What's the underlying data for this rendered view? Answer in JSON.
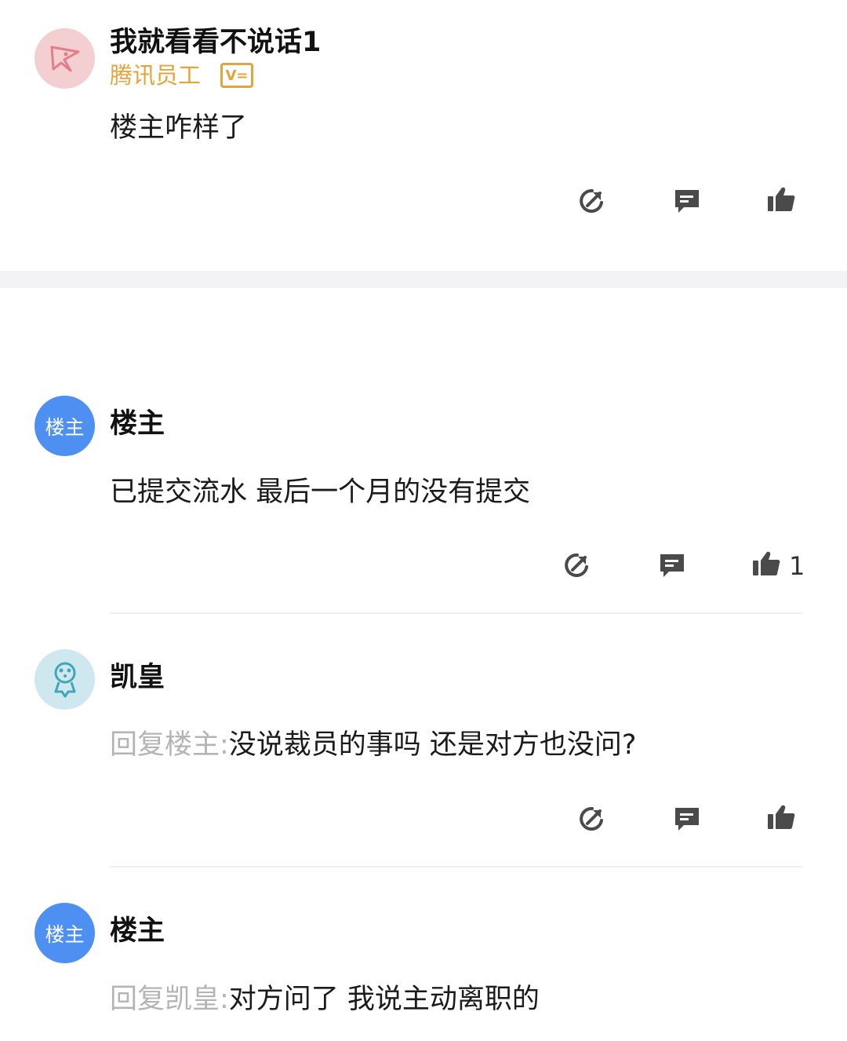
{
  "comments": [
    {
      "author": "我就看看不说话1",
      "badge": "腾讯员工",
      "badge_icon": "V=",
      "text": "楼主咋样了",
      "like_count": ""
    },
    {
      "author": "楼主",
      "avatar_text": "楼主",
      "text": "已提交流水 最后一个月的没有提交",
      "like_count": "1"
    },
    {
      "author": "凯皇",
      "reply_prefix": "回复楼主:",
      "text": "没说裁员的事吗  还是对方也没问?",
      "like_count": ""
    },
    {
      "author": "楼主",
      "avatar_text": "楼主",
      "reply_prefix": "回复凯皇:",
      "text": "对方问了 我说主动离职的"
    }
  ],
  "colors": {
    "badge_orange": "#e3a43a",
    "owner_avatar_blue": "#4e8ff2",
    "reply_prefix_gray": "#b4b4b4",
    "icon_gray": "#4a4a4a"
  },
  "icons": [
    "share-icon",
    "comment-icon",
    "like-icon"
  ]
}
